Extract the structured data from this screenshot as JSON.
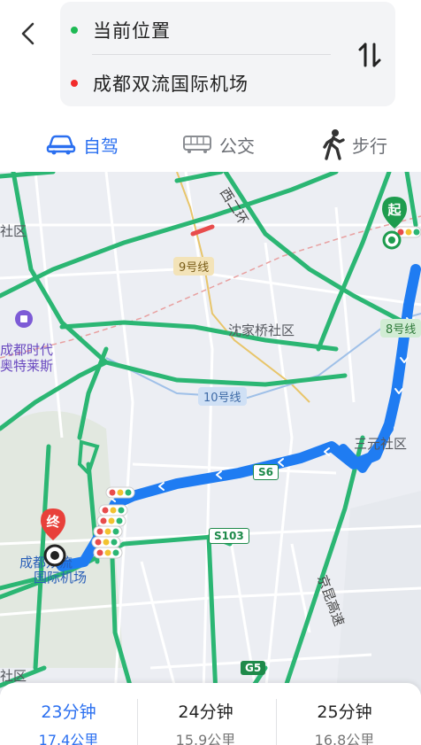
{
  "route": {
    "start_label": "当前位置",
    "end_label": "成都双流国际机场"
  },
  "tabs": [
    {
      "label": "自驾",
      "icon": "car-icon",
      "active": true
    },
    {
      "label": "公交",
      "icon": "bus-icon",
      "active": false
    },
    {
      "label": "步行",
      "icon": "walk-icon",
      "active": false
    }
  ],
  "map": {
    "labels": {
      "community_nw": "社区",
      "outlet_1": "成都时代",
      "outlet_2": "奥特莱斯",
      "shenjiaqiao": "沈家桥社区",
      "sanyuan": "三元社区",
      "community_sw": "社区",
      "airport_1": "成都双流",
      "airport_2": "国际机场",
      "xi_er_huan": "西二环",
      "jingkun": "京昆高速"
    },
    "badges": {
      "line9": "9号线",
      "line10": "10号线",
      "line8": "8号线",
      "s6": "S6",
      "s103": "S103",
      "g5": "G5"
    },
    "markers": {
      "start": "起",
      "end": "终"
    }
  },
  "options": [
    {
      "time": "23分钟",
      "distance": "17.4公里",
      "selected": true
    },
    {
      "time": "24分钟",
      "distance": "15.9公里",
      "selected": false
    },
    {
      "time": "25分钟",
      "distance": "16.8公里",
      "selected": false
    }
  ],
  "colors": {
    "accent": "#2a6ff0",
    "route": "#1f7cf2",
    "road_green": "#2bb673",
    "start_dot": "#1db954",
    "end_dot": "#f22b2b",
    "end_marker": "#e8403a"
  }
}
